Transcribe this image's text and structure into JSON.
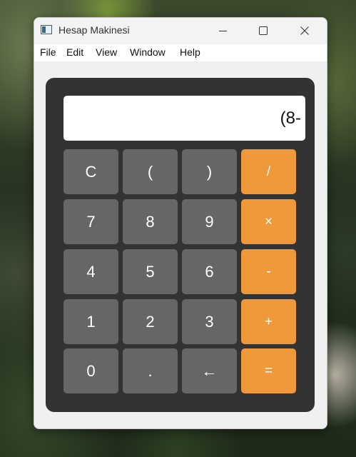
{
  "window": {
    "title": "Hesap Makinesi",
    "controls": {
      "minimize_icon": "minimize-icon",
      "maximize_icon": "maximize-icon",
      "close_icon": "close-icon"
    }
  },
  "menu": {
    "items": [
      {
        "label": "File"
      },
      {
        "label": "Edit"
      },
      {
        "label": "View"
      },
      {
        "label": "Window"
      },
      {
        "label": "Help"
      }
    ]
  },
  "calculator": {
    "display": "(8-",
    "keys": {
      "clear": "C",
      "lparen": "(",
      "rparen": ")",
      "divide": "/",
      "seven": "7",
      "eight": "8",
      "nine": "9",
      "multiply": "×",
      "four": "4",
      "five": "5",
      "six": "6",
      "minus": "-",
      "one": "1",
      "two": "2",
      "three": "3",
      "plus": "+",
      "zero": "0",
      "dot": ".",
      "backspace": "←",
      "equals": "="
    }
  },
  "colors": {
    "panel": "#333333",
    "number_key": "#666666",
    "operator_key": "#f0993a",
    "display_bg": "#ffffff"
  }
}
